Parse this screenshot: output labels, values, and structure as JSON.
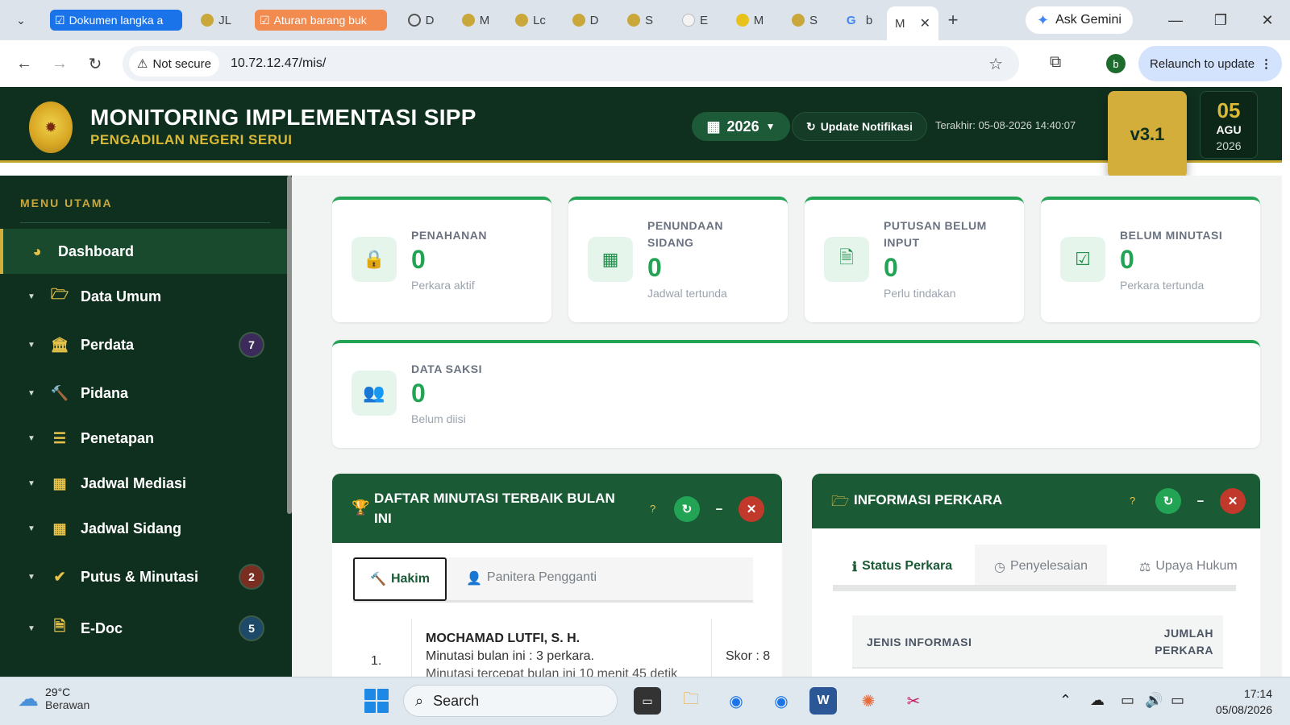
{
  "browser": {
    "tabs": [
      {
        "label": "Dokumen langka a",
        "group": "blue"
      },
      {
        "label": "JL"
      },
      {
        "label": "Aturan barang buk",
        "group": "orange"
      },
      {
        "label": "D"
      },
      {
        "label": "M"
      },
      {
        "label": "Lc"
      },
      {
        "label": "D"
      },
      {
        "label": "S"
      },
      {
        "label": "E"
      },
      {
        "label": "M"
      },
      {
        "label": "S"
      },
      {
        "label": "b"
      },
      {
        "label": "M",
        "active": true
      }
    ],
    "ask_gemini": "Ask Gemini",
    "security_label": "Not secure",
    "url": "10.72.12.47/mis/",
    "profile_initial": "b",
    "relaunch": "Relaunch to update"
  },
  "header": {
    "title": "MONITORING IMPLEMENTASI SIPP",
    "subtitle": "PENGADILAN NEGERI SERUI",
    "year": "2026",
    "update_button": "Update Notifikasi",
    "last_update": "Terakhir: 05-08-2026 14:40:07",
    "version": "v3.1",
    "date_day": "05",
    "date_month": "AGU",
    "date_year": "2026"
  },
  "sidebar": {
    "title": "MENU UTAMA",
    "items": [
      {
        "label": "Dashboard",
        "icon": "dashboard-icon",
        "active": true
      },
      {
        "label": "Data Umum",
        "icon": "folder-open-icon"
      },
      {
        "label": "Perdata",
        "icon": "bank-icon",
        "badge": "7",
        "badge_color": "#3b2a5a"
      },
      {
        "label": "Pidana",
        "icon": "gavel-icon"
      },
      {
        "label": "Penetapan",
        "icon": "list-icon"
      },
      {
        "label": "Jadwal Mediasi",
        "icon": "calendar-icon"
      },
      {
        "label": "Jadwal Sidang",
        "icon": "calendar-icon"
      },
      {
        "label": "Putus & Minutasi",
        "icon": "check-circle-icon",
        "badge": "2",
        "badge_color": "#7a2e22"
      },
      {
        "label": "E-Doc",
        "icon": "word-doc-icon",
        "badge": "5",
        "badge_color": "#1e4a6a"
      }
    ]
  },
  "stats": [
    {
      "label": "PENAHANAN",
      "value": "0",
      "sub": "Perkara aktif",
      "icon": "lock-icon"
    },
    {
      "label_1": "PENUNDAAN",
      "label_2": "SIDANG",
      "value": "0",
      "sub": "Jadwal tertunda",
      "icon": "calendar-x-icon"
    },
    {
      "label_1": "PUTUSAN BELUM",
      "label_2": "INPUT",
      "value": "0",
      "sub": "Perlu tindakan",
      "icon": "file-text-icon"
    },
    {
      "label": "BELUM MINUTASI",
      "value": "0",
      "sub": "Perkara tertunda",
      "icon": "check-square-icon"
    },
    {
      "label": "DATA SAKSI",
      "value": "0",
      "sub": "Belum diisi",
      "icon": "users-icon"
    }
  ],
  "minutasi_panel": {
    "title_1": "DAFTAR MINUTASI TERBAIK BULAN",
    "title_2": "INI",
    "help": "?",
    "tab_active": "Hakim",
    "tab_other": "Panitera Pengganti",
    "entries": [
      {
        "rank": "1.",
        "name": "MOCHAMAD LUTFI, S. H.",
        "line1": "Minutasi bulan ini : 3 perkara.",
        "line2": "Minutasi tercepat bulan ini 10 menit 45 detik",
        "score": "Skor : 8"
      }
    ]
  },
  "info_panel": {
    "title": "INFORMASI PERKARA",
    "help": "?",
    "tabs": [
      "Status Perkara",
      "Penyelesaian",
      "Upaya Hukum"
    ],
    "table_headers": {
      "col1": "JENIS INFORMASI",
      "col2_1": "JUMLAH",
      "col2_2": "PERKARA"
    }
  },
  "taskbar": {
    "temperature": "29°C",
    "weather": "Berawan",
    "search": "Search",
    "time": "17:14",
    "date": "05/08/2026"
  },
  "colors": {
    "header_bg": "#10301f",
    "accent_gold": "#d4ae3a",
    "accent_green": "#23a455"
  }
}
